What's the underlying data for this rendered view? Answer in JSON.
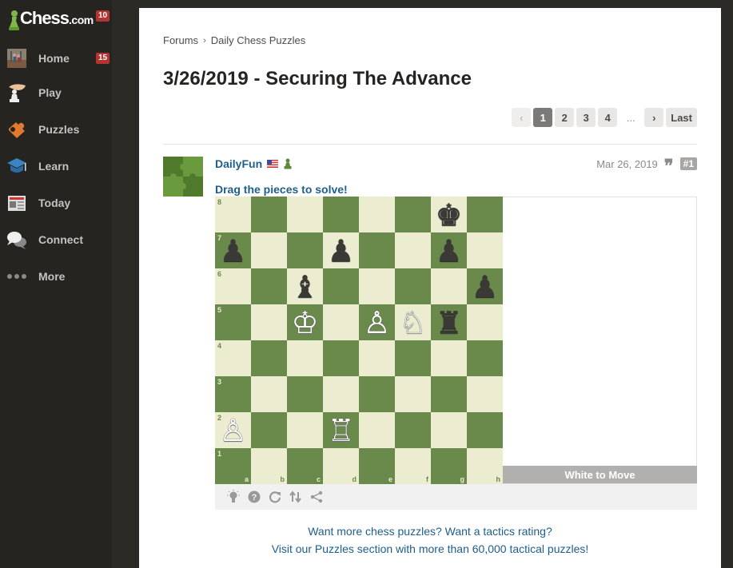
{
  "sidebar": {
    "logo": {
      "text": "Chess",
      "suffix": ".com",
      "badge": "10"
    },
    "items": [
      {
        "label": "Home",
        "icon": "home-avatar-icon",
        "badge": "15"
      },
      {
        "label": "Play",
        "icon": "hand-pawn-icon"
      },
      {
        "label": "Puzzles",
        "icon": "puzzle-piece-icon"
      },
      {
        "label": "Learn",
        "icon": "graduation-cap-icon"
      },
      {
        "label": "Today",
        "icon": "newspaper-icon"
      },
      {
        "label": "Connect",
        "icon": "chat-bubbles-icon"
      },
      {
        "label": "More",
        "icon": "more-dots-icon"
      }
    ]
  },
  "breadcrumb": {
    "items": [
      "Forums",
      "Daily Chess Puzzles"
    ],
    "separator": "›"
  },
  "page_title": "3/26/2019 - Securing The Advance",
  "pagination": {
    "prev": "‹",
    "pages": [
      "1",
      "2",
      "3",
      "4"
    ],
    "current": "1",
    "ellipsis": "...",
    "next": "›",
    "last": "Last"
  },
  "post": {
    "author": "DailyFun",
    "date": "Mar 26, 2019",
    "number": "#1",
    "quote_glyph": "❞",
    "instruction": "Drag the pieces to solve!",
    "status": "White to Move"
  },
  "board": {
    "ranks": [
      "8",
      "7",
      "6",
      "5",
      "4",
      "3",
      "2",
      "1"
    ],
    "files": [
      "a",
      "b",
      "c",
      "d",
      "e",
      "f",
      "g",
      "h"
    ],
    "pieces": {
      "g8": {
        "glyph": "♚",
        "color": "b"
      },
      "a7": {
        "glyph": "♟",
        "color": "b"
      },
      "d7": {
        "glyph": "♟",
        "color": "b"
      },
      "g7": {
        "glyph": "♟",
        "color": "b"
      },
      "c6": {
        "glyph": "♝",
        "color": "b"
      },
      "h6": {
        "glyph": "♟",
        "color": "b"
      },
      "c5": {
        "glyph": "♔",
        "color": "w"
      },
      "e5": {
        "glyph": "♙",
        "color": "w"
      },
      "f5": {
        "glyph": "♘",
        "color": "w"
      },
      "g5": {
        "glyph": "♜",
        "color": "b"
      },
      "a2": {
        "glyph": "♙",
        "color": "w"
      },
      "d2": {
        "glyph": "♖",
        "color": "w"
      }
    },
    "colors": {
      "light": "#ebecd0",
      "dark": "#6a8a4c"
    }
  },
  "toolbar": {
    "buttons": [
      {
        "name": "hint-lightbulb-icon",
        "glyph": "💡"
      },
      {
        "name": "help-question-icon",
        "glyph": "?"
      },
      {
        "name": "retry-refresh-icon",
        "glyph": "↻"
      },
      {
        "name": "flip-board-icon",
        "glyph": "⇅"
      },
      {
        "name": "share-icon",
        "glyph": "<"
      }
    ]
  },
  "promo": {
    "line1": "Want more chess puzzles? Want a tactics rating?",
    "line2": "Visit our Puzzles section with more than 60,000 tactical puzzles!"
  }
}
